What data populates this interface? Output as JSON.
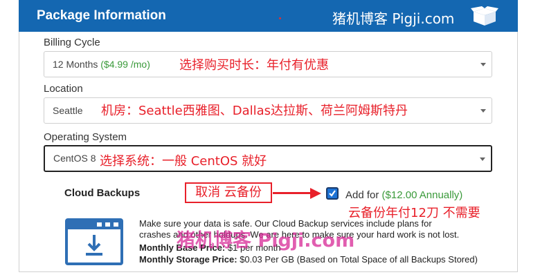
{
  "header": {
    "title": "Package Information",
    "brand": "猪机博客 Pigji.com"
  },
  "billing": {
    "label": "Billing Cycle",
    "value": "12 Months",
    "price": "($4.99 /mo)",
    "annotation": "选择购买时长：年付有优惠"
  },
  "location": {
    "label": "Location",
    "value": "Seattle",
    "annotation": "机房：Seattle西雅图、Dallas达拉斯、荷兰阿姆斯特丹"
  },
  "os": {
    "label": "Operating System",
    "value": "CentOS 8",
    "annotation": "选择系统：一般 CentOS 就好"
  },
  "backups": {
    "label": "Cloud Backups",
    "cancel_annotation": "取消 云备份",
    "checked": true,
    "add_for": "Add for",
    "add_price": "($12.00 Annually)",
    "annotation": "云备份年付12刀 不需要",
    "desc_line1": "Make sure your data is safe. Our Cloud Backup services include plans for",
    "desc_line2": "crashes and other holdups. We are here to make sure your hard work is  not lost.",
    "base_label": "Monthly Base Price:",
    "base_value": " $1 per month",
    "storage_label": "Monthly Storage Price:",
    "storage_value": " $0.03 Per GB (Based on Total Space of all Backups Stored)",
    "watermark": "猪机博客 Pigji.com"
  },
  "colors": {
    "header_bg": "#1467b1",
    "annotation": "#e8202a",
    "price_green": "#3a9a3a",
    "watermark": "#d72896"
  }
}
